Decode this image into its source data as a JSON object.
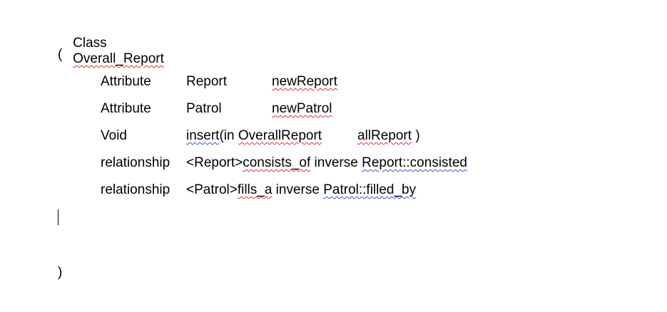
{
  "class_header": {
    "keyword": "Class",
    "name": "Overall_Report"
  },
  "open_paren": "(",
  "rows": [
    {
      "kind": "Attribute",
      "type": "Report",
      "value": "newReport"
    },
    {
      "kind": "Attribute",
      "type": "Patrol",
      "value": "newPatrol"
    },
    {
      "kind": "Void",
      "method_name": "insert",
      "method_open": "(in ",
      "param_type": "OverallReport",
      "param_name": "allReport",
      "method_close": " )"
    },
    {
      "kind": "relationship",
      "target": "<Report>",
      "name": "consists_of",
      "inverse_kw": " inverse ",
      "inverse_target": "Report::consisted"
    },
    {
      "kind": "relationship",
      "target": "<Patrol>",
      "name": "fills_a",
      "inverse_kw": " inverse ",
      "inverse_target": "Patrol::filled_by"
    }
  ],
  "close_paren": ")",
  "colors": {
    "text": "#000000",
    "spell_red": "#e03030",
    "spell_blue": "#3355cc",
    "background": "#ffffff"
  }
}
